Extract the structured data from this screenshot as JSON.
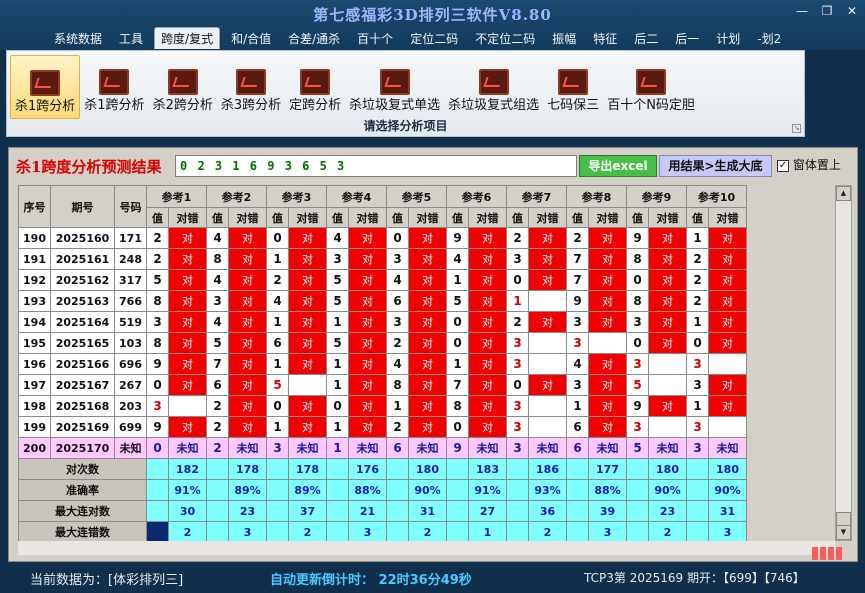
{
  "app": {
    "title": "第七感福彩3D排列三软件V8.80",
    "window_controls": [
      "—",
      "❐",
      "✕"
    ]
  },
  "menu": [
    "系统数据",
    "工具",
    "跨度/复式",
    "和/合值",
    "合差/通杀",
    "百十个",
    "定位二码",
    "不定位二码",
    "振幅",
    "特征",
    "后二",
    "后一",
    "计划",
    "-划2"
  ],
  "menu_active": "跨度/复式",
  "ribbon": {
    "tools": [
      "杀1跨分析",
      "杀1跨分析",
      "杀2跨分析",
      "杀3跨分析",
      "定跨分析",
      "杀垃圾复式单选",
      "杀垃圾复式组选",
      "七码保三",
      "百十个N码定胆"
    ],
    "selected_index": 0,
    "group_label": "请选择分析项目"
  },
  "main": {
    "title": "杀1跨度分析预测结果",
    "result": "0 2 3 1 6 9 3 6 5 3",
    "btn_excel": "导出excel",
    "btn_generate": "用结果>生成大底",
    "checkbox_label": "窗体置上",
    "checkbox_mark": "✓"
  },
  "table": {
    "fixed_headers": [
      "序号",
      "期号",
      "号码"
    ],
    "ref_headers": [
      "参考1",
      "参考2",
      "参考3",
      "参考4",
      "参考5",
      "参考6",
      "参考7",
      "参考8",
      "参考9",
      "参考10"
    ],
    "sub_headers": [
      "值",
      "对错"
    ],
    "mark_text": "对",
    "rows": [
      {
        "seq": "190",
        "period": "2025160",
        "number": "171",
        "vals": [
          "2",
          "4",
          "0",
          "4",
          "0",
          "9",
          "2",
          "2",
          "9",
          "1"
        ],
        "hit": [
          1,
          1,
          1,
          1,
          1,
          1,
          1,
          1,
          1,
          1
        ],
        "hl": [
          0,
          0,
          0,
          0,
          0,
          0,
          0,
          0,
          0,
          0
        ]
      },
      {
        "seq": "191",
        "period": "2025161",
        "number": "248",
        "vals": [
          "2",
          "8",
          "1",
          "3",
          "3",
          "4",
          "3",
          "7",
          "8",
          "2"
        ],
        "hit": [
          1,
          1,
          1,
          1,
          1,
          1,
          1,
          1,
          1,
          1
        ],
        "hl": [
          0,
          0,
          0,
          0,
          0,
          0,
          0,
          0,
          0,
          0
        ]
      },
      {
        "seq": "192",
        "period": "2025162",
        "number": "317",
        "vals": [
          "5",
          "4",
          "2",
          "5",
          "4",
          "1",
          "0",
          "7",
          "0",
          "2"
        ],
        "hit": [
          1,
          1,
          1,
          1,
          1,
          1,
          1,
          1,
          1,
          1
        ],
        "hl": [
          0,
          0,
          0,
          0,
          0,
          0,
          0,
          0,
          0,
          0
        ]
      },
      {
        "seq": "193",
        "period": "2025163",
        "number": "766",
        "vals": [
          "8",
          "3",
          "4",
          "5",
          "6",
          "5",
          "1",
          "9",
          "8",
          "2"
        ],
        "hit": [
          1,
          1,
          1,
          1,
          1,
          1,
          0,
          1,
          1,
          1
        ],
        "hl": [
          0,
          0,
          0,
          0,
          0,
          0,
          1,
          0,
          0,
          0
        ]
      },
      {
        "seq": "194",
        "period": "2025164",
        "number": "519",
        "vals": [
          "3",
          "4",
          "1",
          "1",
          "3",
          "0",
          "2",
          "3",
          "3",
          "1"
        ],
        "hit": [
          1,
          1,
          1,
          1,
          1,
          1,
          1,
          1,
          1,
          1
        ],
        "hl": [
          0,
          0,
          0,
          0,
          0,
          0,
          0,
          0,
          0,
          0
        ]
      },
      {
        "seq": "195",
        "period": "2025165",
        "number": "103",
        "vals": [
          "8",
          "5",
          "6",
          "5",
          "2",
          "0",
          "3",
          "3",
          "0",
          "0"
        ],
        "hit": [
          1,
          1,
          1,
          1,
          1,
          1,
          0,
          0,
          1,
          1
        ],
        "hl": [
          0,
          0,
          0,
          0,
          0,
          0,
          1,
          1,
          0,
          0
        ]
      },
      {
        "seq": "196",
        "period": "2025166",
        "number": "696",
        "vals": [
          "9",
          "7",
          "1",
          "1",
          "4",
          "1",
          "3",
          "4",
          "3",
          "3"
        ],
        "hit": [
          1,
          1,
          1,
          1,
          1,
          1,
          0,
          1,
          0,
          0
        ],
        "hl": [
          0,
          0,
          0,
          0,
          0,
          0,
          1,
          0,
          1,
          1
        ]
      },
      {
        "seq": "197",
        "period": "2025167",
        "number": "267",
        "vals": [
          "0",
          "6",
          "5",
          "1",
          "8",
          "7",
          "0",
          "3",
          "5",
          "3"
        ],
        "hit": [
          1,
          1,
          0,
          1,
          1,
          1,
          1,
          1,
          0,
          1
        ],
        "hl": [
          0,
          0,
          1,
          0,
          0,
          0,
          0,
          0,
          1,
          0
        ]
      },
      {
        "seq": "198",
        "period": "2025168",
        "number": "203",
        "vals": [
          "3",
          "2",
          "0",
          "0",
          "1",
          "8",
          "3",
          "1",
          "9",
          "1"
        ],
        "hit": [
          0,
          1,
          1,
          1,
          1,
          1,
          0,
          1,
          1,
          1
        ],
        "hl": [
          1,
          0,
          0,
          0,
          0,
          0,
          1,
          0,
          0,
          0
        ]
      },
      {
        "seq": "199",
        "period": "2025169",
        "number": "699",
        "vals": [
          "9",
          "2",
          "1",
          "1",
          "2",
          "0",
          "3",
          "6",
          "3",
          "3"
        ],
        "hit": [
          1,
          1,
          1,
          1,
          1,
          1,
          0,
          1,
          0,
          0
        ],
        "hl": [
          0,
          0,
          0,
          0,
          0,
          0,
          1,
          0,
          1,
          1
        ]
      }
    ],
    "pred": {
      "seq": "200",
      "period": "2025170",
      "number": "未知",
      "vals": [
        "0",
        "2",
        "3",
        "1",
        "6",
        "9",
        "3",
        "6",
        "5",
        "3"
      ],
      "mark": "未知"
    },
    "stats": [
      {
        "label": "对次数",
        "values": [
          "182",
          "178",
          "178",
          "176",
          "180",
          "183",
          "186",
          "177",
          "180",
          "180"
        ]
      },
      {
        "label": "准确率",
        "values": [
          "91%",
          "89%",
          "89%",
          "88%",
          "90%",
          "91%",
          "93%",
          "88%",
          "90%",
          "90%"
        ]
      },
      {
        "label": "最大连对数",
        "values": [
          "30",
          "23",
          "37",
          "21",
          "31",
          "27",
          "36",
          "39",
          "23",
          "31"
        ]
      },
      {
        "label": "最大连错数",
        "values": [
          "2",
          "3",
          "2",
          "3",
          "2",
          "1",
          "2",
          "3",
          "2",
          "3"
        ]
      }
    ]
  },
  "colors": {
    "hit": "#f00000",
    "prediction_row": "#ffc8ff",
    "stats_row": "#80ffff",
    "highlight_text": "#d00000"
  },
  "status": {
    "data_source": "当前数据为：[体彩排列三]",
    "timer": "自动更新倒计时： 22时36分49秒",
    "draw": "TCP3第 2025169 期开：【699】【746】"
  }
}
